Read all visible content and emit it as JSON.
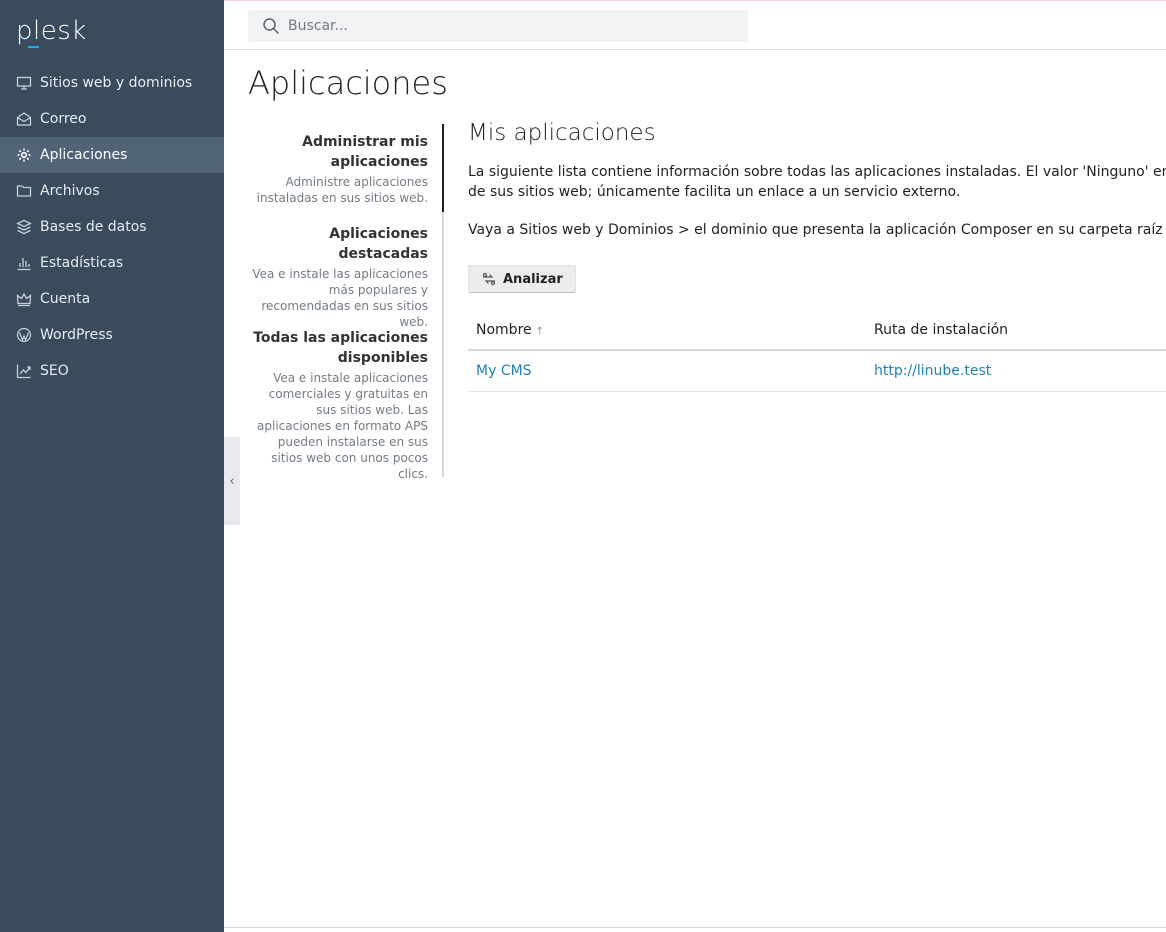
{
  "logo": {
    "text": "plesk"
  },
  "sidebar": {
    "items": [
      {
        "label": "Sitios web y dominios",
        "icon": "monitor-icon",
        "active": false
      },
      {
        "label": "Correo",
        "icon": "mail-icon",
        "active": false
      },
      {
        "label": "Aplicaciones",
        "icon": "gear-icon",
        "active": true
      },
      {
        "label": "Archivos",
        "icon": "folder-icon",
        "active": false
      },
      {
        "label": "Bases de datos",
        "icon": "database-layers-icon",
        "active": false
      },
      {
        "label": "Estadísticas",
        "icon": "bar-chart-icon",
        "active": false
      },
      {
        "label": "Cuenta",
        "icon": "crown-icon",
        "active": false
      },
      {
        "label": "WordPress",
        "icon": "wordpress-icon",
        "active": false
      },
      {
        "label": "SEO",
        "icon": "trend-chart-icon",
        "active": false
      }
    ]
  },
  "search": {
    "placeholder": "Buscar..."
  },
  "page": {
    "title": "Aplicaciones"
  },
  "subnav": [
    {
      "title": "Administrar mis aplicaciones",
      "desc": "Administre aplicaciones instaladas en sus sitios web."
    },
    {
      "title": "Aplicaciones destacadas",
      "desc": "Vea e instale las aplicaciones más populares y recomendadas en sus sitios web."
    },
    {
      "title": "Todas las aplicaciones disponibles",
      "desc": "Vea e instale aplicaciones comerciales y gratuitas en sus sitios web. Las aplicaciones en formato APS pueden instalarse en sus sitios web con unos pocos clics."
    }
  ],
  "main": {
    "heading": "Mis aplicaciones",
    "para1_line1": "La siguiente lista contiene información sobre todas las aplicaciones instaladas. El valor 'Ninguno' en la colur",
    "para1_line2": "de sus sitios web; únicamente facilita un enlace a un servicio externo.",
    "para2": "Vaya a Sitios web y Dominios > el dominio que presenta la aplicación Composer en su carpeta raíz de docur",
    "analyze_button": "Analizar",
    "table": {
      "headers": [
        "Nombre",
        "Ruta de instalación"
      ],
      "sort_indicator": "↑",
      "rows": [
        {
          "name": "My CMS",
          "path": "http://linube.test"
        }
      ]
    }
  },
  "colors": {
    "sidebar_bg": "#3a4b5c",
    "sidebar_active": "#506377",
    "link": "#1f83b5",
    "logo_accent": "#28aade"
  }
}
